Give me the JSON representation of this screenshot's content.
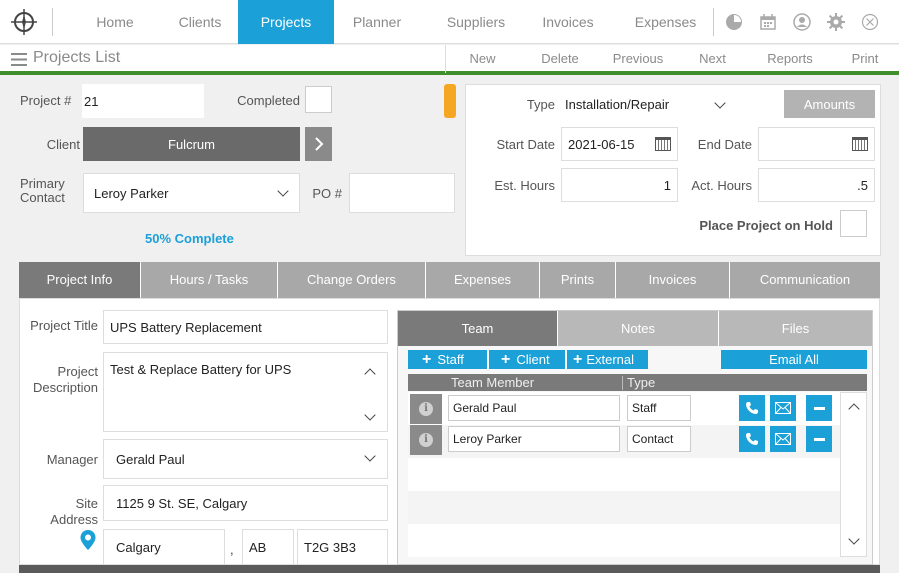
{
  "nav": {
    "items": [
      "Home",
      "Clients",
      "Projects",
      "Planner",
      "Suppliers",
      "Invoices",
      "Expenses"
    ],
    "active": "Projects",
    "icons": [
      "compass-logo-icon",
      "clock-icon",
      "calendar-icon",
      "user-icon",
      "gear-icon",
      "close-icon"
    ]
  },
  "subbar": {
    "title": "Projects List",
    "actions": [
      "New",
      "Delete",
      "Previous",
      "Next",
      "Reports",
      "Print"
    ]
  },
  "project": {
    "number_label": "Project #",
    "number": "21",
    "completed_label": "Completed",
    "client_label": "Client",
    "client": "Fulcrum",
    "contact_label": "Primary Contact",
    "contact": "Leroy Parker",
    "po_label": "PO #",
    "po": "",
    "progress": "50% Complete",
    "type_label": "Type",
    "type": "Installation/Repair",
    "amounts_label": "Amounts",
    "start_label": "Start Date",
    "start": "2021-06-15",
    "end_label": "End Date",
    "end": "",
    "est_label": "Est. Hours",
    "est": "1",
    "act_label": "Act. Hours",
    "act": ".5",
    "hold_label": "Place Project on Hold"
  },
  "tabs": [
    "Project Info",
    "Hours / Tasks",
    "Change Orders",
    "Expenses",
    "Prints",
    "Invoices",
    "Communication"
  ],
  "info": {
    "title_label": "Project Title",
    "title": "UPS Battery Replacement",
    "desc_label": "Project Description",
    "desc": "Test & Replace Battery for UPS",
    "manager_label": "Manager",
    "manager": "Gerald Paul",
    "site_label": "Site Address",
    "address": "1125 9 St. SE, Calgary",
    "city": "Calgary",
    "province": "AB",
    "postal": "T2G 3B3"
  },
  "team": {
    "subtabs": [
      "Team",
      "Notes",
      "Files"
    ],
    "add_staff": "Staff",
    "add_client": "Client",
    "add_external": "External",
    "email_all": "Email All",
    "col_member": "Team Member",
    "col_type": "Type",
    "rows": [
      {
        "name": "Gerald Paul",
        "type": "Staff"
      },
      {
        "name": "Leroy Parker",
        "type": "Contact"
      }
    ]
  },
  "colors": {
    "accent": "#1ba0d8",
    "green_bar": "#3f8f2c",
    "orange": "#f5a623",
    "tab_gray": "#a8a8a8"
  }
}
